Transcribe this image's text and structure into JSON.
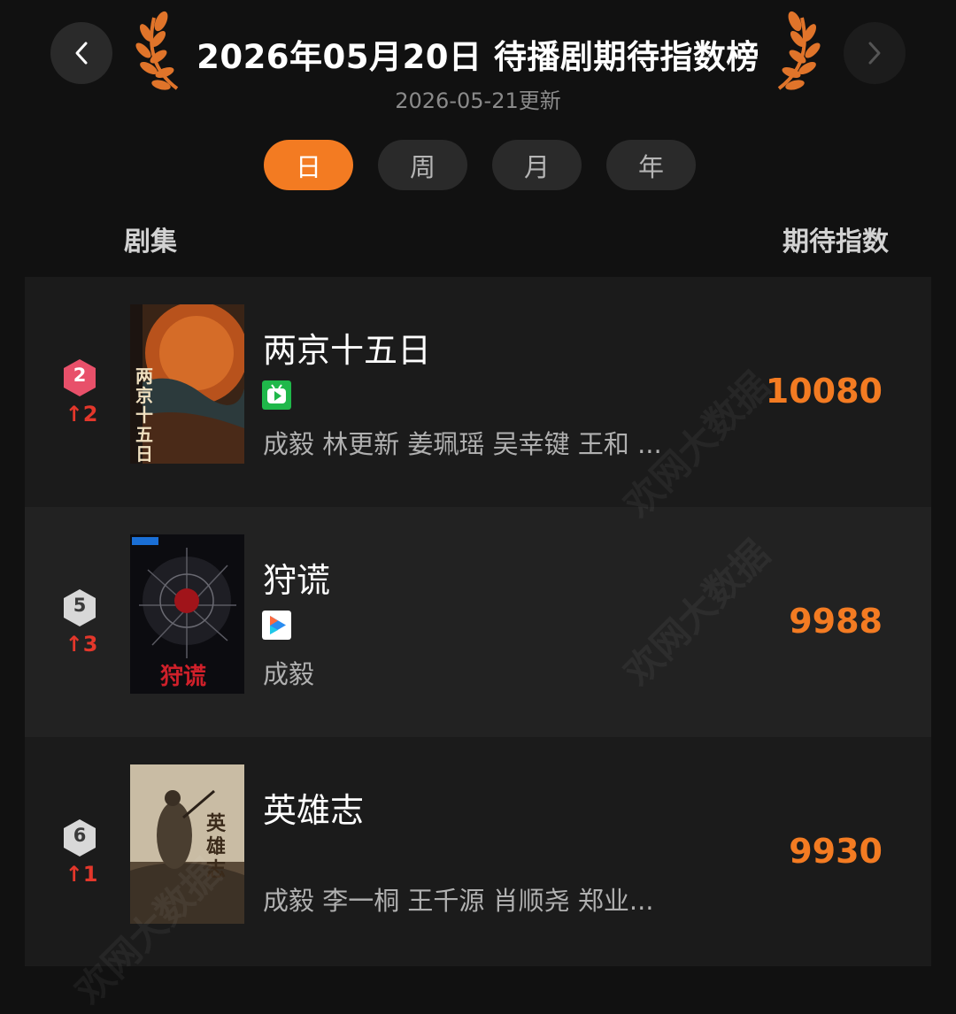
{
  "header": {
    "title": "2026年05月20日 待播剧期待指数榜",
    "subtitle": "2026-05-21更新",
    "prev_icon": "chevron-left-icon",
    "next_icon": "chevron-right-icon"
  },
  "tabs": [
    {
      "label": "日",
      "active": true
    },
    {
      "label": "周",
      "active": false
    },
    {
      "label": "月",
      "active": false
    },
    {
      "label": "年",
      "active": false
    }
  ],
  "columns": {
    "left": "剧集",
    "right": "期待指数"
  },
  "rows": [
    {
      "rank": "2",
      "change": "↑2",
      "title": "两京十五日",
      "platform_icon": "iqiyi-icon",
      "cast": "成毅 林更新 姜珮瑶 吴幸键 王和 ...",
      "score": "10080",
      "poster_text": "两京十五日"
    },
    {
      "rank": "5",
      "change": "↑3",
      "title": "狩谎",
      "platform_icon": "youku-icon",
      "cast": "成毅",
      "score": "9988",
      "poster_text": "狩谎"
    },
    {
      "rank": "6",
      "change": "↑1",
      "title": "英雄志",
      "platform_icon": "",
      "cast": "成毅 李一桐 王千源 肖顺尧 郑业...",
      "score": "9930",
      "poster_text": "英雄志"
    }
  ],
  "watermark": "欢网大数据",
  "colors": {
    "accent": "#f37b22",
    "rank_up": "#e4372b",
    "top_badge": "#e8506a",
    "badge": "#d8d8d8",
    "background": "#111111"
  }
}
